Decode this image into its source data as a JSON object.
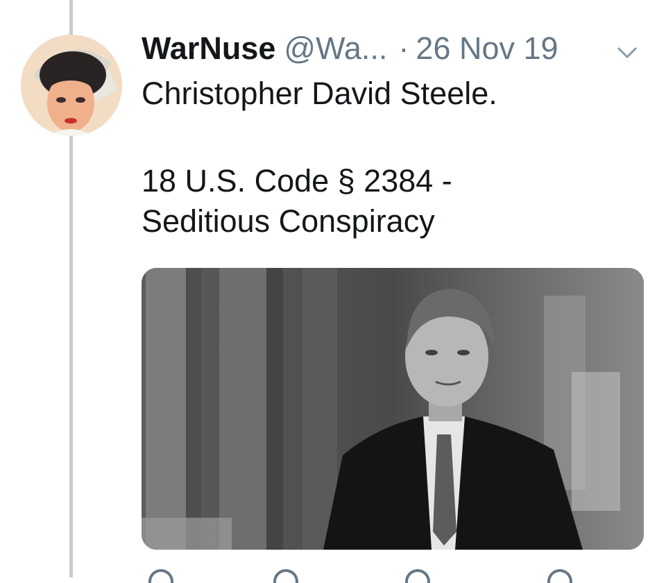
{
  "tweet": {
    "display_name": "WarNuse",
    "handle": "@Wa...",
    "separator": "·",
    "date": "26 Nov 19",
    "lines": [
      "Christopher David Steele.",
      "18 U.S. Code § 2384 -",
      "Seditious Conspiracy"
    ]
  },
  "icons": {
    "caret": "chevron-down-icon",
    "reply": "reply-icon",
    "retweet": "retweet-icon",
    "like": "heart-icon",
    "share": "share-icon"
  },
  "colors": {
    "text": "#14171a",
    "secondary": "#657786",
    "thread_line": "#c4ccd4"
  }
}
